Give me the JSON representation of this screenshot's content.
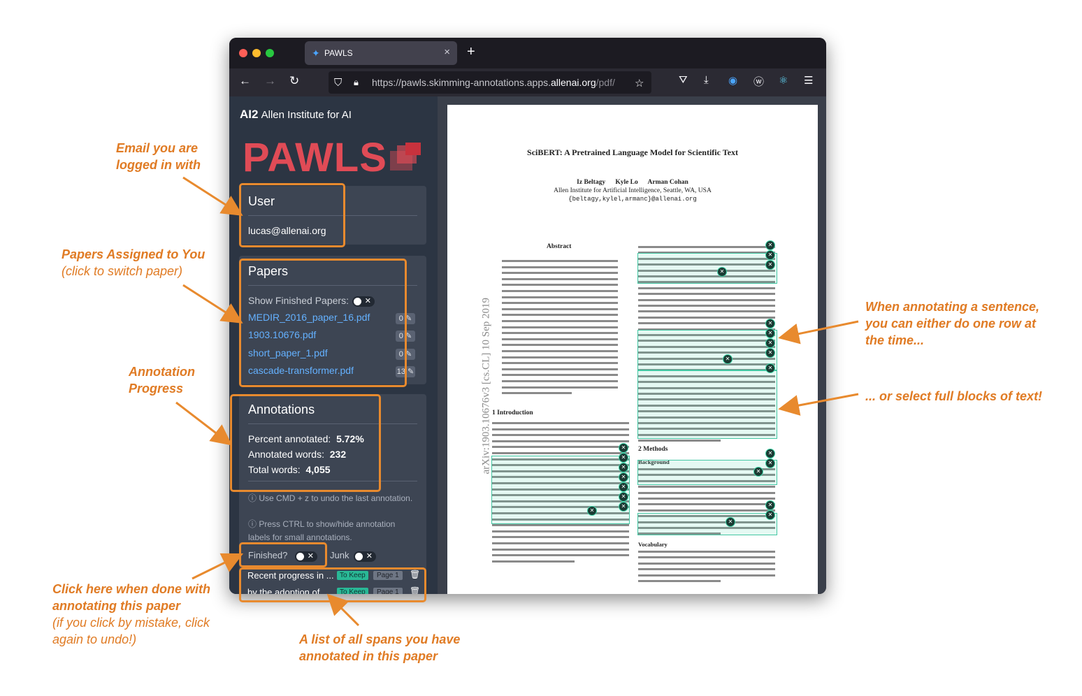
{
  "browser": {
    "tab_title": "PAWLS",
    "url_prefix": "https://pawls.skimming-annotations.apps.",
    "url_domain": "allenai.org",
    "url_suffix": "/pdf/"
  },
  "sidebar": {
    "org_mark": "AI2",
    "org_name": "Allen Institute for AI",
    "app_name": "PAWLS",
    "user": {
      "title": "User",
      "email": "lucas@allenai.org"
    },
    "papers": {
      "title": "Papers",
      "show_finished_label": "Show Finished Papers:",
      "items": [
        {
          "name": "MEDIR_2016_paper_16.pdf",
          "count": "0"
        },
        {
          "name": "1903.10676.pdf",
          "count": "0"
        },
        {
          "name": "short_paper_1.pdf",
          "count": "0"
        },
        {
          "name": "cascade-transformer.pdf",
          "count": "13"
        }
      ]
    },
    "annotations": {
      "title": "Annotations",
      "percent_label": "Percent annotated:",
      "percent_value": "5.72%",
      "annotated_label": "Annotated words:",
      "annotated_value": "232",
      "total_label": "Total words:",
      "total_value": "4,055"
    },
    "hints": [
      "Use CMD + z to undo the last annotation.",
      "Press CTRL to show/hide annotation labels for small annotations."
    ],
    "finished_label": "Finished?",
    "junk_label": "Junk",
    "spans": [
      {
        "text": "Recent progress in ...",
        "tag": "To Keep",
        "page": "Page 1"
      },
      {
        "text": "by the adoption of ...",
        "tag": "To Keep",
        "page": "Page 1"
      }
    ]
  },
  "pdf": {
    "title": "SciBERT: A Pretrained Language Model for Scientific Text",
    "authors": "Iz Beltagy      Kyle Lo      Arman Cohan",
    "affiliation": "Allen Institute for Artificial Intelligence, Seattle, WA, USA",
    "emails": "{beltagy,kylel,armanc}@allenai.org",
    "arxiv": "arXiv:1903.10676v3  [cs.CL]  10 Sep 2019",
    "abstract_heading": "Abstract",
    "intro_heading": "1   Introduction",
    "methods_heading": "2   Methods",
    "background_heading": "Background",
    "vocab_heading": "Vocabulary"
  },
  "callouts": {
    "email": "Email you are logged in with",
    "papers": "Papers  Assigned  to You",
    "papers_sub": "(click to switch paper)",
    "progress": "Annotation Progress",
    "finished": "Click here when done with annotating this paper",
    "finished_sub": "(if you click by mistake, click again to undo!)",
    "spans": "A list of all spans you have annotated in this paper",
    "sentence": "When annotating a sentence, you can either do one row at the time...",
    "blocks": "... or select full blocks of text!"
  },
  "colors": {
    "accent": "#e07b24",
    "highlight": "#43c7a3",
    "brand_red": "#e04b56"
  }
}
